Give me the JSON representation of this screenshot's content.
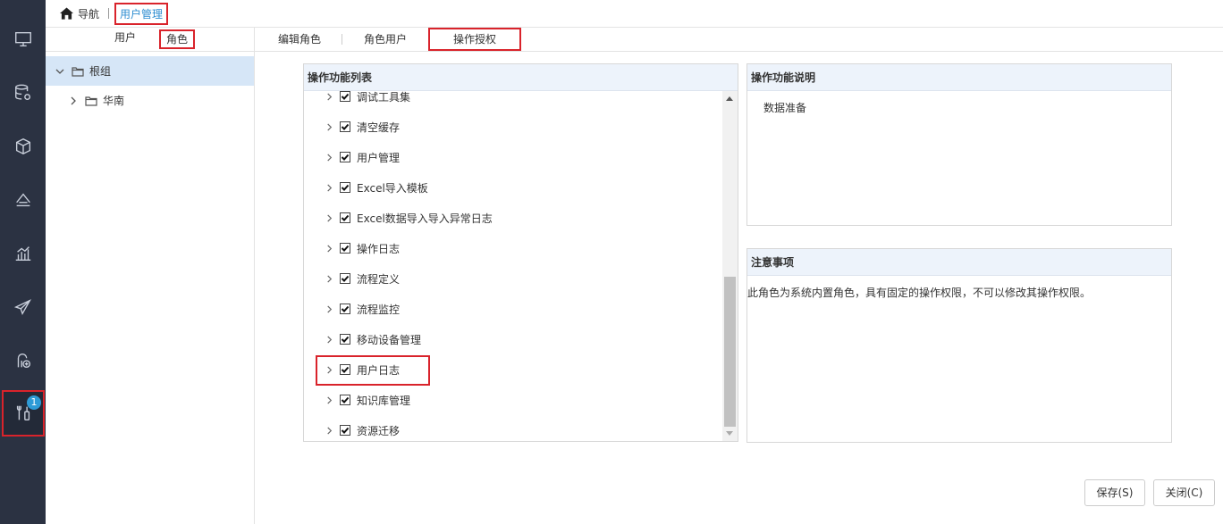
{
  "breadcrumb": {
    "home_label": "导航",
    "current": "用户管理"
  },
  "rail": {
    "icons": [
      "monitor-icon",
      "database-gear-icon",
      "cube-icon",
      "layers-icon",
      "bar-chart-icon",
      "send-icon",
      "mobile-chart-icon",
      "tools-icon"
    ],
    "badge": "1"
  },
  "left_tabs": {
    "user": "用户",
    "role": "角色"
  },
  "tree": {
    "root": "根组",
    "child": "华南"
  },
  "tabs": {
    "edit_role": "编辑角色",
    "role_users": "角色用户",
    "op_auth": "操作授权"
  },
  "list": {
    "title": "操作功能列表",
    "items": [
      "调试工具集",
      "清空缓存",
      "用户管理",
      "Excel导入模板",
      "Excel数据导入导入异常日志",
      "操作日志",
      "流程定义",
      "流程监控",
      "移动设备管理",
      "用户日志",
      "知识库管理",
      "资源迁移"
    ]
  },
  "desc": {
    "title": "操作功能说明",
    "text": "数据准备"
  },
  "notes": {
    "title": "注意事项",
    "text": "此角色为系统内置角色，具有固定的操作权限，不可以修改其操作权限。"
  },
  "buttons": {
    "save": "保存(S)",
    "close": "关闭(C)"
  },
  "colors": {
    "rail_bg": "#2b3242",
    "highlight_red": "#d9232b",
    "link_blue": "#2e8ed1",
    "selected_row": "#d6e6f7",
    "badge_blue": "#2e9bd6"
  }
}
